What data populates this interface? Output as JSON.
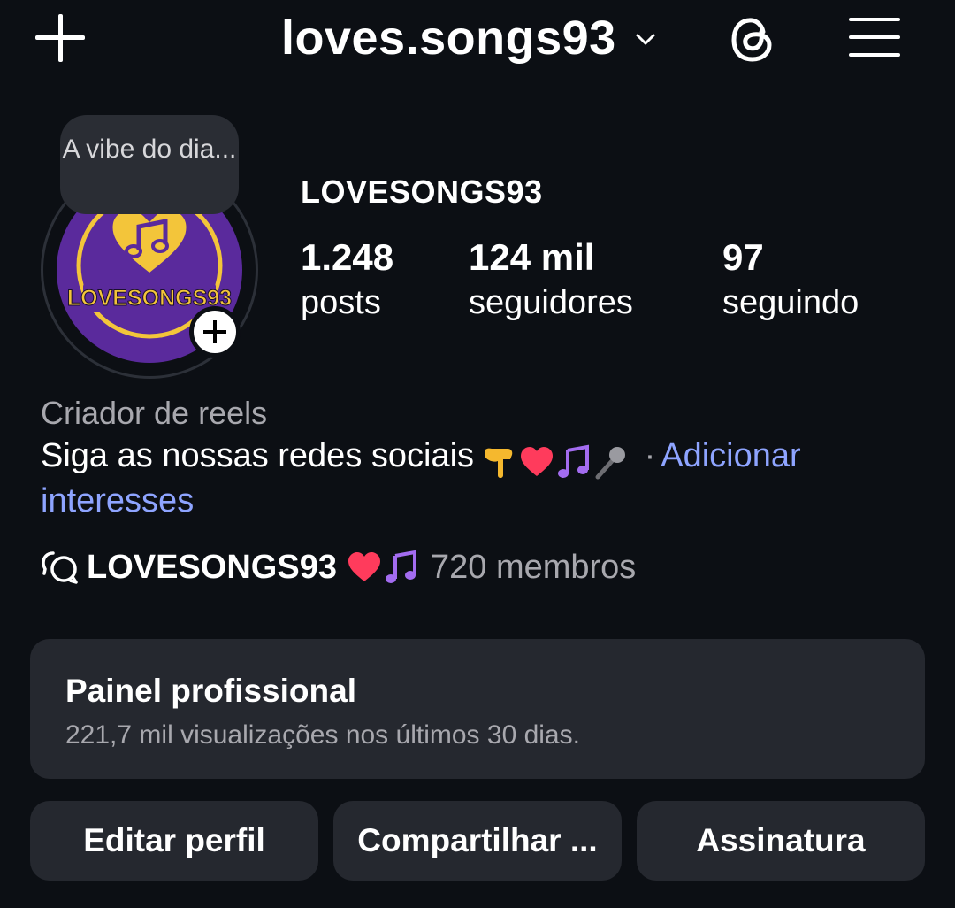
{
  "header": {
    "username": "loves.songs93",
    "icons": [
      "plus-icon",
      "chevron-down-icon",
      "threads-icon",
      "menu-icon"
    ]
  },
  "profile": {
    "note": "A vibe do dia...",
    "avatar_text": "LOVESONGS93",
    "display_name": "LOVESONGS93",
    "stats": {
      "posts_value": "1.248",
      "posts_label": "posts",
      "followers_value": "124 mil",
      "followers_label": "seguidores",
      "following_value": "97",
      "following_label": "seguindo"
    },
    "category": "Criador de reels",
    "bio_text": "Siga as nossas redes sociais",
    "bio_emojis": [
      "pointing-down",
      "red-heart",
      "musical-notes",
      "microphone"
    ],
    "bio_separator": "·",
    "bio_link": "Adicionar interesses"
  },
  "channel": {
    "name": "LOVESONGS93",
    "emojis": [
      "red-heart",
      "musical-notes"
    ],
    "members": "720 membros"
  },
  "professional_panel": {
    "title": "Painel profissional",
    "subtitle": "221,7 mil visualizações nos últimos 30 dias."
  },
  "buttons": {
    "edit": "Editar perfil",
    "share": "Compartilhar ...",
    "subscription": "Assinatura"
  },
  "colors": {
    "background": "#0c0f14",
    "card": "#25282f",
    "link": "#8ea4ff",
    "secondary_text": "#a8a8ae",
    "avatar_purple": "#5a2a9c",
    "avatar_gold": "#f3c53a"
  }
}
